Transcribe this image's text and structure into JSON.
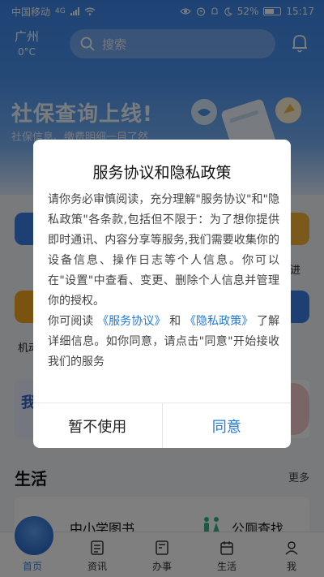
{
  "status_bar": {
    "carrier": "中国移动",
    "network": "4G",
    "battery": "52%",
    "time": "15:17"
  },
  "header": {
    "city": "广州",
    "temperature": "0°C",
    "search_placeholder": "搜索"
  },
  "banner": {
    "title": "社保查询上线!",
    "subtitle": "社保信息、缴费明细一目了然"
  },
  "partial_labels": {
    "left_row2": "机动",
    "right_row1": "进"
  },
  "promo": {
    "left_text": "我"
  },
  "life_section": {
    "title": "生活",
    "more": "更多",
    "items": [
      "中小学图书",
      "公厕查找"
    ]
  },
  "tabbar": {
    "tabs": [
      {
        "label": "首页",
        "icon": "home-icon",
        "active": true
      },
      {
        "label": "资讯",
        "icon": "news-icon",
        "active": false
      },
      {
        "label": "办事",
        "icon": "service-icon",
        "active": false
      },
      {
        "label": "生活",
        "icon": "calendar-icon",
        "active": false
      },
      {
        "label": "我",
        "icon": "user-icon",
        "active": false
      }
    ]
  },
  "dialog": {
    "title": "服务协议和隐私政策",
    "body_part1": "请你务必审慎阅读，充分理解\"服务协议\"和\"隐私政策\"各条款,包括但不限于：为了想你提供即时通讯、内容分享等服务,我们需要收集你的设备信息、操作日志等个人信息。你可以在\"设置\"中查看、变更、删除个人信息并管理你的授权。",
    "body_part2_prefix": "你可阅读",
    "link_service": "《服务协议》",
    "conjunction": "和",
    "link_privacy": "《隐私政策》",
    "body_part2_suffix": "了解详细信息。如你同意，请点击\"同意\"开始接收我们的服务",
    "decline_label": "暂不使用",
    "agree_label": "同意"
  },
  "colors": {
    "accent": "#1f7ae0",
    "hero": "#4b93ef",
    "mask": "rgba(0,0,0,0.5)"
  }
}
